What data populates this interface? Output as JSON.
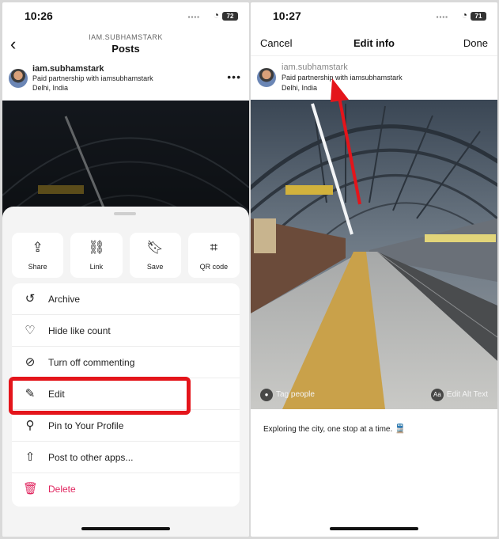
{
  "left": {
    "status": {
      "time": "10:26",
      "battery": "72"
    },
    "header": {
      "account": "IAM.SUBHAMSTARK",
      "title": "Posts"
    },
    "post": {
      "username": "iam.subhamstark",
      "partnership": "Paid partnership with iamsubhamstark",
      "location": "Delhi, India"
    },
    "share_tiles": [
      {
        "label": "Share",
        "icon": "share-icon"
      },
      {
        "label": "Link",
        "icon": "link-icon"
      },
      {
        "label": "Save",
        "icon": "bookmark-icon"
      },
      {
        "label": "QR code",
        "icon": "qr-code-icon"
      }
    ],
    "menu": [
      {
        "label": "Archive",
        "icon": "archive-icon"
      },
      {
        "label": "Hide like count",
        "icon": "heart-off-icon"
      },
      {
        "label": "Turn off commenting",
        "icon": "comment-off-icon"
      },
      {
        "label": "Edit",
        "icon": "pencil-icon"
      },
      {
        "label": "Pin to Your Profile",
        "icon": "pin-icon"
      },
      {
        "label": "Post to other apps...",
        "icon": "share-out-icon"
      },
      {
        "label": "Delete",
        "icon": "trash-icon",
        "danger_color": "#e0245e"
      }
    ],
    "highlight_color": "#e4151b"
  },
  "right": {
    "status": {
      "time": "10:27",
      "battery": "71"
    },
    "header": {
      "cancel": "Cancel",
      "title": "Edit info",
      "done": "Done"
    },
    "post": {
      "username": "iam.subhamstark",
      "partnership": "Paid partnership with iamsubhamstark",
      "location": "Delhi, India"
    },
    "tag_people": "Tag people",
    "alt_text": "Edit Alt Text",
    "alt_badge": "Aa",
    "caption": "Exploring the city, one stop at a time.",
    "caption_emoji": "🚆",
    "arrow_color": "#e4151b"
  }
}
